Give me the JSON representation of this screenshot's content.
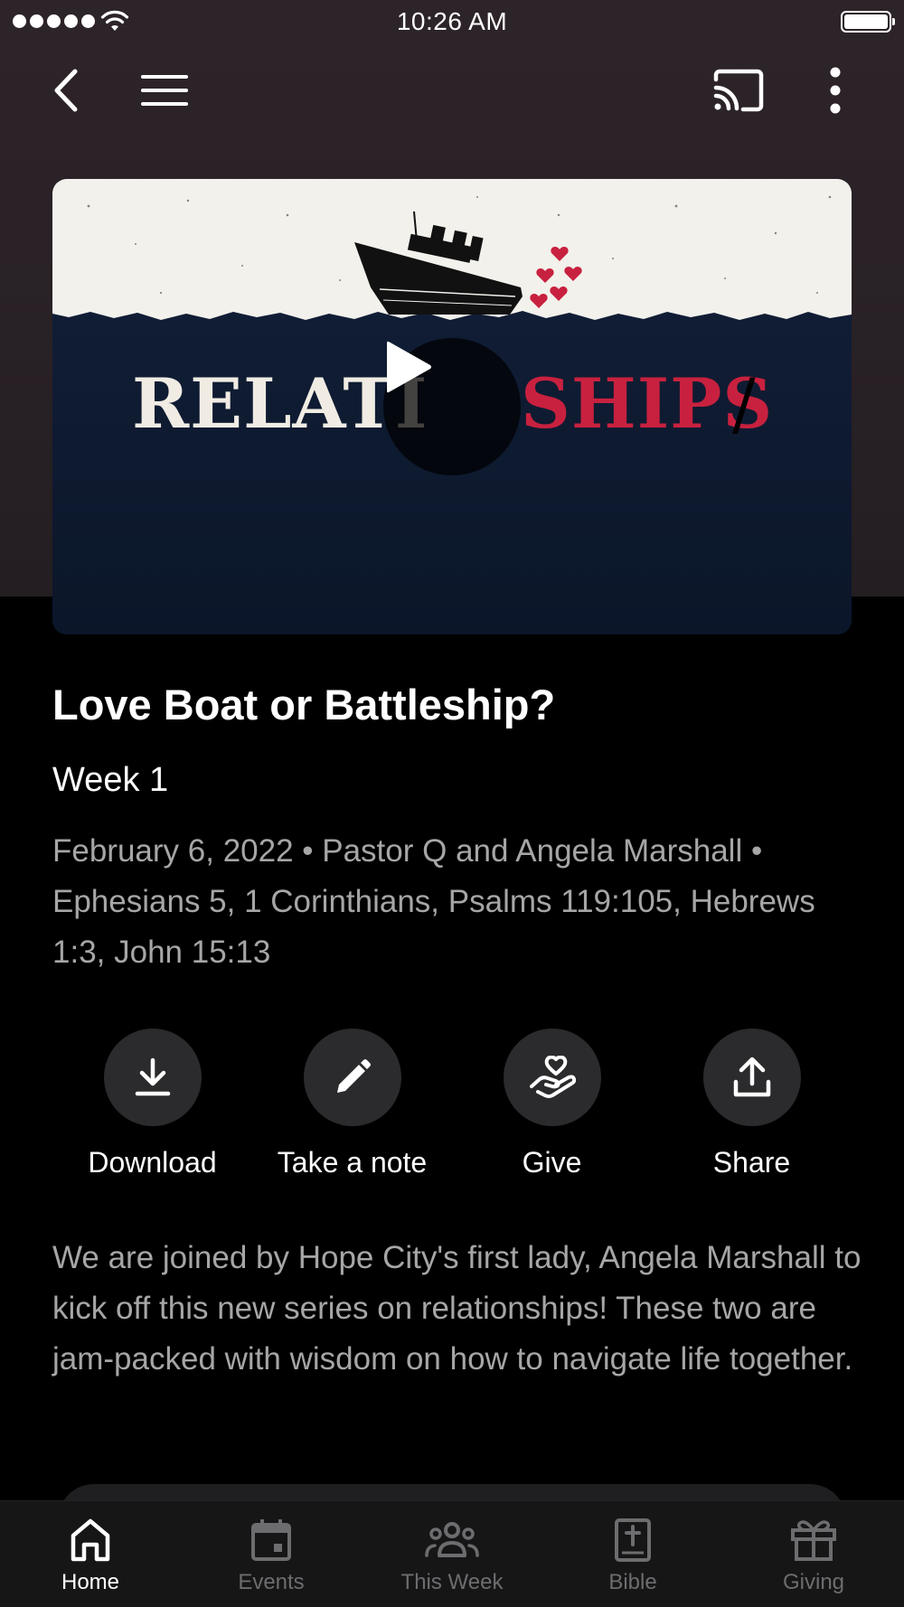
{
  "status_bar": {
    "time": "10:26 AM"
  },
  "toolbar": {
    "back_icon": "chevron-left-icon",
    "menu_icon": "hamburger-menu-icon",
    "cast_icon": "cast-icon",
    "more_icon": "more-vertical-icon"
  },
  "video": {
    "artwork_text_left": "RELATIONSHIPS",
    "artwork_text_left_visible": "RELATI",
    "artwork_text_right": "SHIPS",
    "artwork_slash": "/",
    "play_icon": "play-icon"
  },
  "sermon": {
    "title": "Love Boat or Battleship?",
    "subtitle": "Week 1",
    "meta": "February 6, 2022 • Pastor Q and Angela Marshall • Ephesians 5, 1 Corinthians, Psalms 119:105, Hebrews 1:3, John 15:13",
    "description": "We are joined by Hope City's first lady, Angela Marshall to kick off this new series on relationships! These two are jam-packed with wisdom on how to navigate life together."
  },
  "actions": [
    {
      "label": "Download",
      "icon": "download-icon"
    },
    {
      "label": "Take a note",
      "icon": "pencil-icon"
    },
    {
      "label": "Give",
      "icon": "giving-hand-heart-icon"
    },
    {
      "label": "Share",
      "icon": "share-icon"
    }
  ],
  "tabs": [
    {
      "label": "Home",
      "icon": "home-icon",
      "active": true
    },
    {
      "label": "Events",
      "icon": "calendar-icon",
      "active": false
    },
    {
      "label": "This Week",
      "icon": "people-icon",
      "active": false
    },
    {
      "label": "Bible",
      "icon": "bible-icon",
      "active": false
    },
    {
      "label": "Giving",
      "icon": "gift-icon",
      "active": false
    }
  ],
  "colors": {
    "accent_red": "#c8213f",
    "background": "#000000",
    "header_background": "#2a2227",
    "secondary_text": "#a6a6a6",
    "tab_inactive": "#6d6d70"
  }
}
